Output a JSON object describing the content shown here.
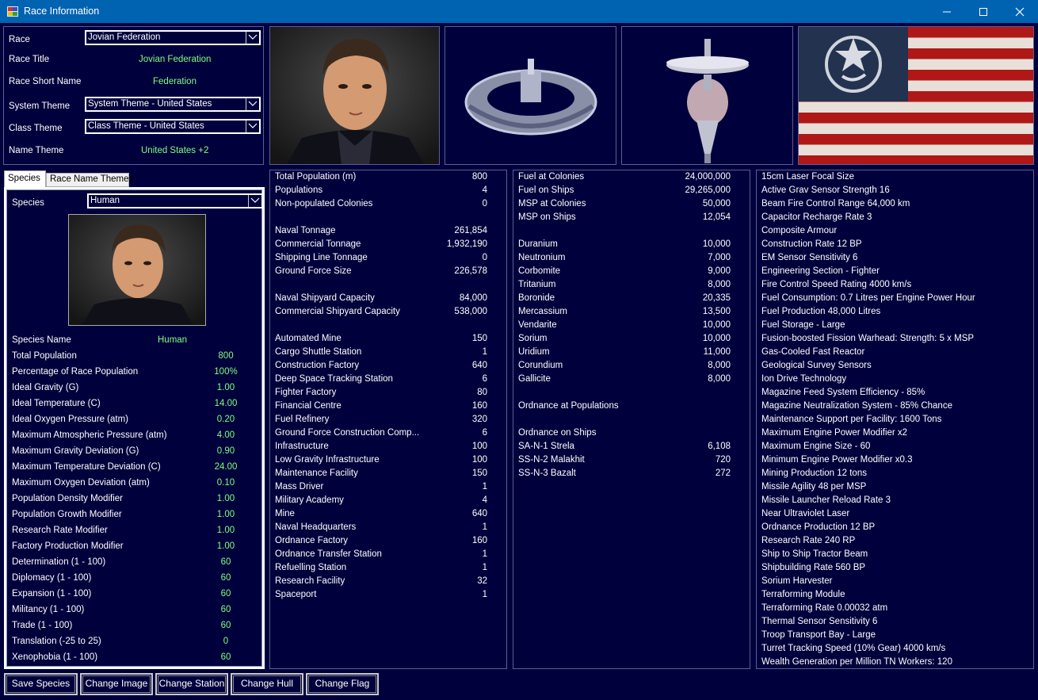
{
  "window": {
    "title": "Race Information"
  },
  "race": {
    "race_label": "Race",
    "race_value": "Jovian Federation",
    "title_label": "Race Title",
    "title_value": "Jovian Federation",
    "short_label": "Race Short Name",
    "short_value": "Federation",
    "system_theme_label": "System Theme",
    "system_theme_value": "System Theme - United States",
    "class_theme_label": "Class Theme",
    "class_theme_value": "Class Theme - United States",
    "name_theme_label": "Name Theme",
    "name_theme_value": "United States +2"
  },
  "tabs": {
    "species": "Species",
    "race_name_themes": "Race Name Themes"
  },
  "species": {
    "species_label": "Species",
    "species_value": "Human",
    "name_label": "Species Name",
    "name_value": "Human",
    "stats": [
      {
        "k": "Total Population",
        "v": "800"
      },
      {
        "k": "Percentage of Race Population",
        "v": "100%"
      },
      {
        "k": "Ideal Gravity (G)",
        "v": "1.00"
      },
      {
        "k": "Ideal Temperature (C)",
        "v": "14.00"
      },
      {
        "k": "Ideal Oxygen Pressure (atm)",
        "v": "0.20"
      },
      {
        "k": "Maximum Atmospheric Pressure (atm)",
        "v": "4.00"
      },
      {
        "k": "Maximum Gravity Deviation (G)",
        "v": "0.90"
      },
      {
        "k": "Maximum Temperature Deviation (C)",
        "v": "24.00"
      },
      {
        "k": "Maximum Oxygen Deviation (atm)",
        "v": "0.10"
      },
      {
        "k": "Population Density Modifier",
        "v": "1.00"
      },
      {
        "k": "Population Growth Modifier",
        "v": "1.00"
      },
      {
        "k": "Research Rate Modifier",
        "v": "1.00"
      },
      {
        "k": "Factory Production Modifier",
        "v": "1.00"
      },
      {
        "k": "Determination (1 - 100)",
        "v": "60"
      },
      {
        "k": "Diplomacy (1 - 100)",
        "v": "60"
      },
      {
        "k": "Expansion (1 - 100)",
        "v": "60"
      },
      {
        "k": "Militancy (1 - 100)",
        "v": "60"
      },
      {
        "k": "Trade (1 - 100)",
        "v": "60"
      },
      {
        "k": "Translation (-25 to 25)",
        "v": "0"
      },
      {
        "k": "Xenophobia (1 - 100)",
        "v": "60"
      }
    ]
  },
  "population": {
    "rows": [
      {
        "k": "Total Population (m)",
        "v": "800"
      },
      {
        "k": "Populations",
        "v": "4"
      },
      {
        "k": "Non-populated Colonies",
        "v": "0"
      },
      {
        "k": "",
        "v": ""
      },
      {
        "k": "Naval Tonnage",
        "v": "261,854"
      },
      {
        "k": "Commercial Tonnage",
        "v": "1,932,190"
      },
      {
        "k": "Shipping Line Tonnage",
        "v": "0"
      },
      {
        "k": "Ground Force Size",
        "v": "226,578"
      },
      {
        "k": "",
        "v": ""
      },
      {
        "k": "Naval Shipyard Capacity",
        "v": "84,000"
      },
      {
        "k": "Commercial Shipyard Capacity",
        "v": "538,000"
      },
      {
        "k": "",
        "v": ""
      },
      {
        "k": "Automated Mine",
        "v": "150"
      },
      {
        "k": "Cargo Shuttle Station",
        "v": "1"
      },
      {
        "k": "Construction Factory",
        "v": "640"
      },
      {
        "k": "Deep Space Tracking Station",
        "v": "6"
      },
      {
        "k": "Fighter Factory",
        "v": "80"
      },
      {
        "k": "Financial Centre",
        "v": "160"
      },
      {
        "k": "Fuel Refinery",
        "v": "320"
      },
      {
        "k": "Ground Force Construction Comp...",
        "v": "6"
      },
      {
        "k": "Infrastructure",
        "v": "100"
      },
      {
        "k": "Low Gravity Infrastructure",
        "v": "100"
      },
      {
        "k": "Maintenance Facility",
        "v": "150"
      },
      {
        "k": "Mass Driver",
        "v": "1"
      },
      {
        "k": "Military Academy",
        "v": "4"
      },
      {
        "k": "Mine",
        "v": "640"
      },
      {
        "k": "Naval Headquarters",
        "v": "1"
      },
      {
        "k": "Ordnance Factory",
        "v": "160"
      },
      {
        "k": "Ordnance Transfer Station",
        "v": "1"
      },
      {
        "k": "Refuelling Station",
        "v": "1"
      },
      {
        "k": "Research Facility",
        "v": "32"
      },
      {
        "k": "Spaceport",
        "v": "1"
      }
    ]
  },
  "resources": {
    "rows": [
      {
        "k": "Fuel at Colonies",
        "v": "24,000,000"
      },
      {
        "k": "Fuel on Ships",
        "v": "29,265,000"
      },
      {
        "k": "MSP at Colonies",
        "v": "50,000"
      },
      {
        "k": "MSP on Ships",
        "v": "12,054"
      },
      {
        "k": "",
        "v": ""
      },
      {
        "k": "Duranium",
        "v": "10,000"
      },
      {
        "k": "Neutronium",
        "v": "7,000"
      },
      {
        "k": "Corbomite",
        "v": "9,000"
      },
      {
        "k": "Tritanium",
        "v": "8,000"
      },
      {
        "k": "Boronide",
        "v": "20,335"
      },
      {
        "k": "Mercassium",
        "v": "13,500"
      },
      {
        "k": "Vendarite",
        "v": "10,000"
      },
      {
        "k": "Sorium",
        "v": "10,000"
      },
      {
        "k": "Uridium",
        "v": "11,000"
      },
      {
        "k": "Corundium",
        "v": "8,000"
      },
      {
        "k": "Gallicite",
        "v": "8,000"
      },
      {
        "k": "",
        "v": ""
      },
      {
        "k": "Ordnance at Populations",
        "v": ""
      },
      {
        "k": "",
        "v": ""
      },
      {
        "k": "Ordnance on Ships",
        "v": ""
      },
      {
        "k": "SA-N-1 Strela",
        "v": "6,108"
      },
      {
        "k": "SS-N-2 Malakhit",
        "v": "720"
      },
      {
        "k": "SS-N-3 Bazalt",
        "v": "272"
      }
    ]
  },
  "tech": {
    "items": [
      "15cm Laser Focal Size",
      "Active Grav Sensor Strength 16",
      "Beam Fire Control Range 64,000 km",
      "Capacitor Recharge Rate 3",
      "Composite Armour",
      "Construction Rate 12 BP",
      "EM Sensor Sensitivity 6",
      "Engineering Section - Fighter",
      "Fire Control Speed Rating 4000 km/s",
      "Fuel Consumption: 0.7 Litres per Engine Power Hour",
      "Fuel Production 48,000 Litres",
      "Fuel Storage - Large",
      "Fusion-boosted Fission Warhead: Strength: 5 x MSP",
      "Gas-Cooled Fast Reactor",
      "Geological Survey Sensors",
      "Ion Drive Technology",
      "Magazine Feed System Efficiency - 85%",
      "Magazine Neutralization System - 85% Chance",
      "Maintenance Support per Facility: 1600 Tons",
      "Maximum Engine Power Modifier x2",
      "Maximum Engine Size - 60",
      "Minimum Engine Power Modifier x0.3",
      "Mining Production 12 tons",
      "Missile Agility 48 per MSP",
      "Missile Launcher Reload Rate 3",
      "Near Ultraviolet Laser",
      "Ordnance Production 12 BP",
      "Research Rate 240 RP",
      "Ship to Ship Tractor Beam",
      "Shipbuilding Rate 560 BP",
      "Sorium Harvester",
      "Terraforming Module",
      "Terraforming Rate 0.00032 atm",
      "Thermal Sensor Sensitivity 6",
      "Troop Transport Bay - Large",
      "Turret Tracking Speed (10% Gear) 4000 km/s",
      "Wealth Generation per Million TN Workers: 120"
    ]
  },
  "buttons": {
    "save_species": "Save Species",
    "change_image": "Change Image",
    "change_station": "Change Station",
    "change_hull": "Change Hull",
    "change_flag": "Change Flag"
  },
  "icons": {
    "minimize": "minimize-icon",
    "maximize": "maximize-icon",
    "close": "close-icon",
    "dropdown": "chevron-down-icon",
    "app": "app-icon"
  },
  "colors": {
    "background": "#00003c",
    "titlebar": "#0063b1",
    "value_green": "#7fff7f",
    "border": "#5a5f92"
  }
}
